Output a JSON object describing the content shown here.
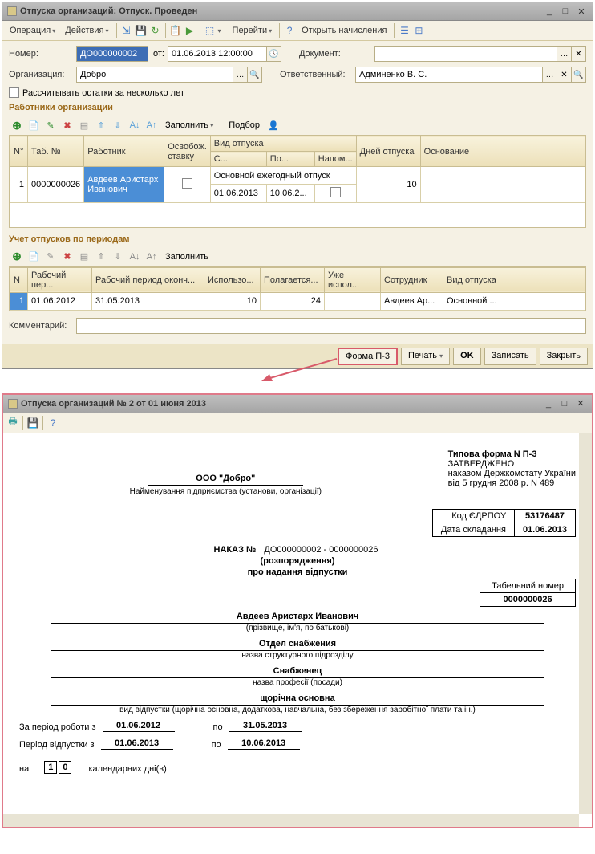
{
  "window1": {
    "title": "Отпуска организаций: Отпуск. Проведен",
    "toolbar": {
      "operation": "Операция",
      "actions": "Действия",
      "goto": "Перейти",
      "open_calc": "Открыть начисления"
    },
    "form": {
      "number_label": "Номер:",
      "number_value": "ДО000000002",
      "from_label": "от:",
      "from_value": "01.06.2013 12:00:00",
      "doc_label": "Документ:",
      "org_label": "Организация:",
      "org_value": "Добро",
      "resp_label": "Ответственный:",
      "resp_value": "Админенко В. С.",
      "multi_year": "Рассчитывать остатки за несколько лет"
    },
    "section1": {
      "title": "Работники организации",
      "fill": "Заполнить",
      "selection": "Подбор",
      "cols": {
        "n": "N°",
        "tab": "Таб. №",
        "worker": "Работник",
        "free": "Освобож. ставку",
        "vtype": "Вид отпуска",
        "from": "С...",
        "to": "По...",
        "remind": "Напом...",
        "days": "Дней отпуска",
        "basis": "Основание"
      },
      "row": {
        "n": "1",
        "tab": "0000000026",
        "worker": "Авдеев Аристарх Иванович",
        "vtype": "Основной ежегодный отпуск",
        "from": "01.06.2013",
        "to": "10.06.2...",
        "days": "10"
      }
    },
    "section2": {
      "title": "Учет отпусков по периодам",
      "fill": "Заполнить",
      "cols": {
        "n": "N",
        "wp": "Рабочий пер...",
        "wpe": "Рабочий период оконч...",
        "used": "Использо...",
        "due": "Полагается...",
        "already": "Уже испол...",
        "emp": "Сотрудник",
        "vtype": "Вид отпуска"
      },
      "row": {
        "n": "1",
        "wp": "01.06.2012",
        "wpe": "31.05.2013",
        "used": "10",
        "due": "24",
        "emp": "Авдеев Ар...",
        "vtype": "Основной ..."
      }
    },
    "comment_label": "Комментарий:",
    "footer": {
      "form": "Форма П-3",
      "print": "Печать",
      "ok": "OK",
      "save": "Записать",
      "close": "Закрыть"
    }
  },
  "window2": {
    "title": "Отпуска организаций № 2 от 01 июня 2013",
    "doc": {
      "company": "ООО \"Добро\"",
      "company_sub": "Найменування підприємства (установи, організації)",
      "form_name": "Типова форма N П-3",
      "approved1": "ЗАТВЕРДЖЕНО",
      "approved2": "наказом Держкомстату України",
      "approved3": "від 5 грудня 2008 р. N 489",
      "edrpou_label": "Код ЄДРПОУ",
      "edrpou": "53176487",
      "date_label": "Дата складання",
      "date": "01.06.2013",
      "order": "НАКАЗ №",
      "order_num": "ДО000000002 - 0000000026",
      "order_sub1": "(розпорядження)",
      "order_sub2": "про надання відпустки",
      "tabnum_label": "Табельний номер",
      "tabnum": "0000000026",
      "person": "Авдеев Аристарх Иванович",
      "person_sub": "(прізвище, ім'я, по батькові)",
      "dept": "Отдел снабжения",
      "dept_sub": "назва структурного підрозділу",
      "job": "Снабженец",
      "job_sub": "назва професії (посади)",
      "vtype": "щорічна основна",
      "vtype_sub": "вид відпустки (щорічна основна, додаткова, навчальна, без збереження заробітної плати та ін.)",
      "work_period_label": "За період роботи з",
      "work_from": "01.06.2012",
      "to_label": "по",
      "work_to": "31.05.2013",
      "vac_period_label": "Період відпустки з",
      "vac_from": "01.06.2013",
      "vac_to": "10.06.2013",
      "for_label": "на",
      "days1": "1",
      "days2": "0",
      "days_label": "календарних дні(в)"
    }
  }
}
